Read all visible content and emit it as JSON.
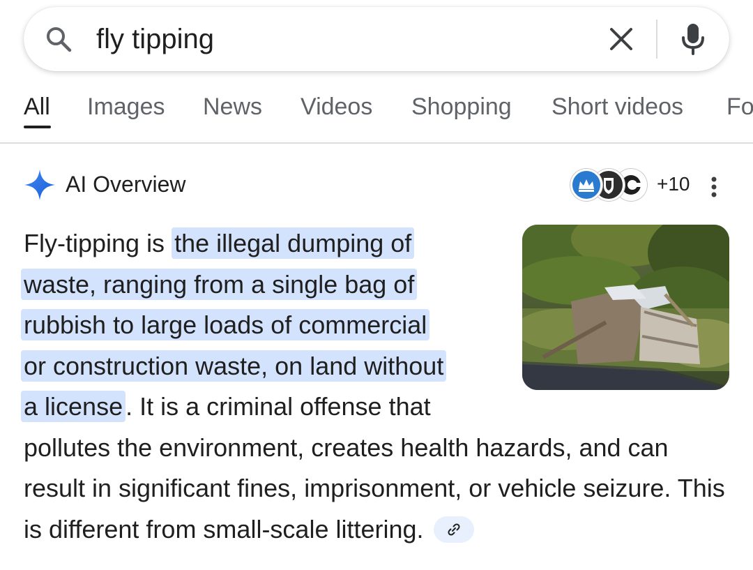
{
  "search": {
    "query": "fly tipping"
  },
  "tabs": [
    {
      "label": "All",
      "active": true
    },
    {
      "label": "Images"
    },
    {
      "label": "News"
    },
    {
      "label": "Videos"
    },
    {
      "label": "Shopping"
    },
    {
      "label": "Short videos"
    },
    {
      "label": "Fo"
    }
  ],
  "ai_overview": {
    "title": "AI Overview",
    "sources_more": "+10",
    "text_before": "Fly-tipping is ",
    "highlight_1": "the illegal dumping of",
    "highlight_2": "waste, ranging from a single bag of",
    "highlight_3": "rubbish to large loads of commercial",
    "highlight_4": "or construction waste, on land without",
    "highlight_5": "a license",
    "text_after": ". It is a criminal offense that pollutes the environment, creates health hazards, and can result in significant fines, imprisonment, or vehicle seizure. This is different from small-scale littering.",
    "image_icon": "fly-tipping-photo"
  },
  "colors": {
    "accent_blue": "#1a73e8",
    "highlight": "#d3e3fd",
    "chip": "#e8f0fe",
    "muted": "#5f6368"
  },
  "icons": [
    "search-icon",
    "clear-icon",
    "mic-icon",
    "sparkle-icon",
    "more-vert-icon",
    "link-icon"
  ]
}
